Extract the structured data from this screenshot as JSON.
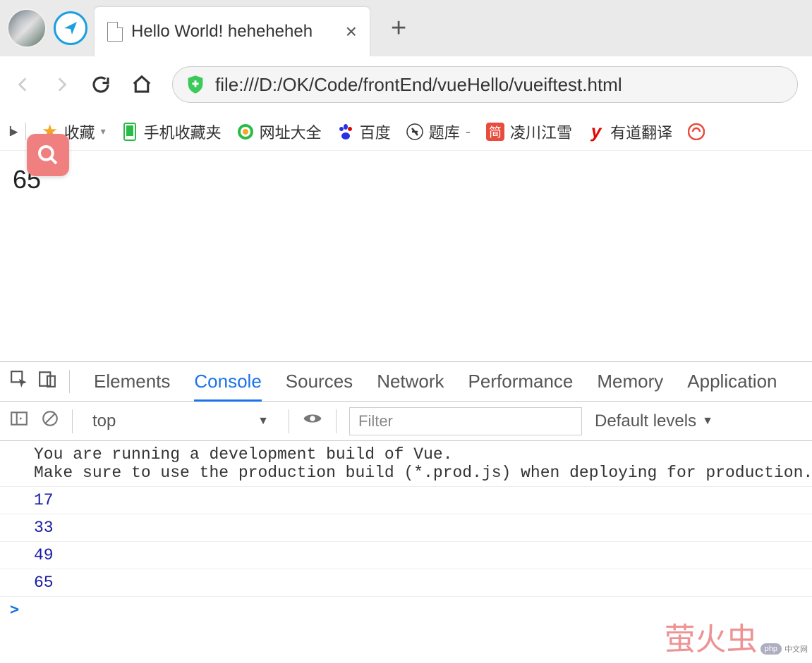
{
  "tab": {
    "title": "Hello World! heheheheh"
  },
  "address": {
    "url": "file:///D:/OK/Code/frontEnd/vueHello/vueiftest.html"
  },
  "bookmarks": {
    "fav_label": "收藏",
    "mobile_fav": "手机收藏夹",
    "url_list": "网址大全",
    "baidu": "百度",
    "tiku": "题库",
    "lingchuan": "凌川江雪",
    "youdao": "有道翻译"
  },
  "page": {
    "display_value": "65"
  },
  "devtools": {
    "tabs": [
      "Elements",
      "Console",
      "Sources",
      "Network",
      "Performance",
      "Memory",
      "Application"
    ],
    "active_tab": "Console",
    "context": "top",
    "filter_placeholder": "Filter",
    "levels_label": "Default levels",
    "messages": [
      {
        "type": "msg",
        "text": "You are running a development build of Vue.\nMake sure to use the production build (*.prod.js) when deploying for production."
      },
      {
        "type": "num",
        "text": "17"
      },
      {
        "type": "num",
        "text": "33"
      },
      {
        "type": "num",
        "text": "49"
      },
      {
        "type": "num",
        "text": "65"
      }
    ],
    "prompt": ">"
  },
  "watermark": {
    "main": "萤火虫",
    "sub": "中文网",
    "badge": "php"
  }
}
